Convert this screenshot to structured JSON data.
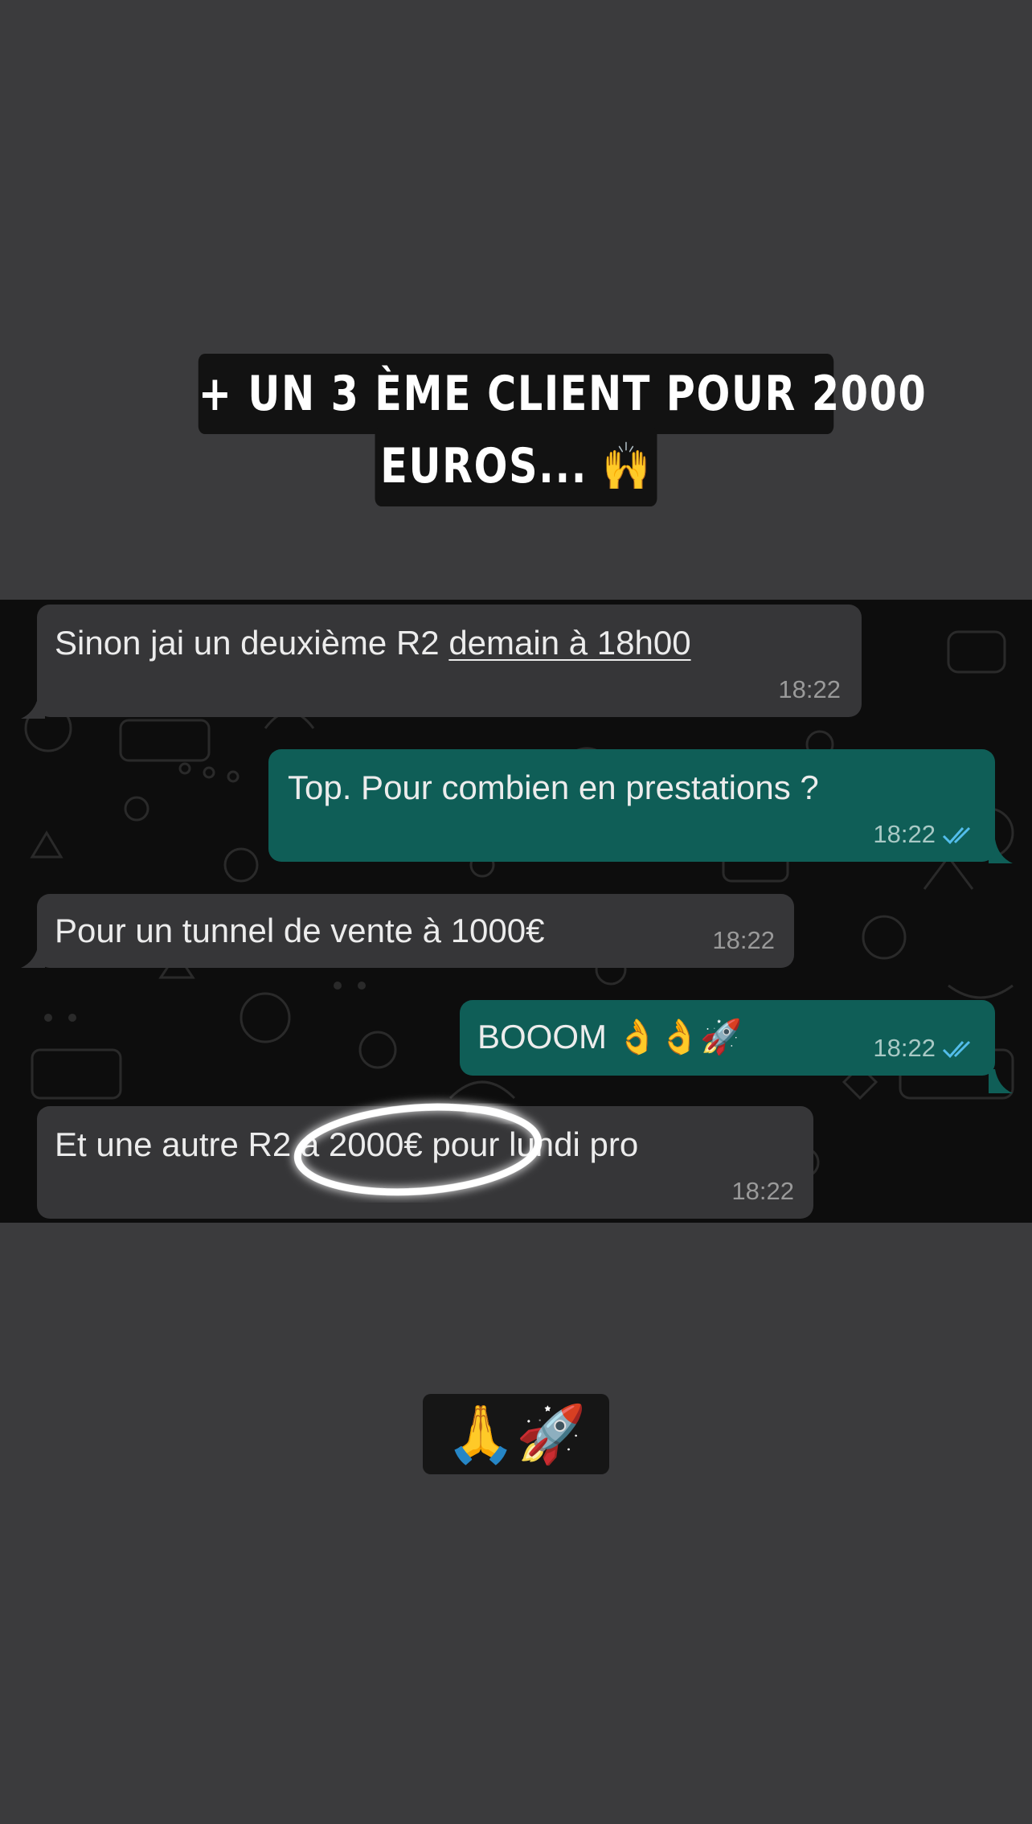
{
  "caption": {
    "line1": "+ UN 3 ÈME CLIENT POUR 2000",
    "line2": "EUROS...",
    "line2_emoji": "🙌"
  },
  "messages": [
    {
      "direction": "incoming",
      "text_plain": "Sinon jai un deuxième R2 ",
      "text_link": "demain à 18h00",
      "time": "18:22"
    },
    {
      "direction": "outgoing",
      "text": "Top. Pour combien en prestations ?",
      "time": "18:22",
      "read": true
    },
    {
      "direction": "incoming",
      "text": "Pour un tunnel de vente à 1000€",
      "time": "18:22"
    },
    {
      "direction": "outgoing",
      "text": "BOOOM 👌👌🚀",
      "time": "18:22",
      "read": true
    },
    {
      "direction": "incoming",
      "text": "Et une autre R2 a 2000€ pour lundi pro",
      "time": "18:22",
      "highlighted": "a 2000€"
    }
  ],
  "sticker": {
    "emojis": "🙏🚀"
  },
  "colors": {
    "story_background": "#3b3b3d",
    "chat_background": "#0d0d0d",
    "incoming_bubble": "#363638",
    "outgoing_bubble": "#0f5e57",
    "read_ticks": "#53bdeb"
  },
  "icons": [
    "double-check-icon",
    "highlight-circle"
  ]
}
